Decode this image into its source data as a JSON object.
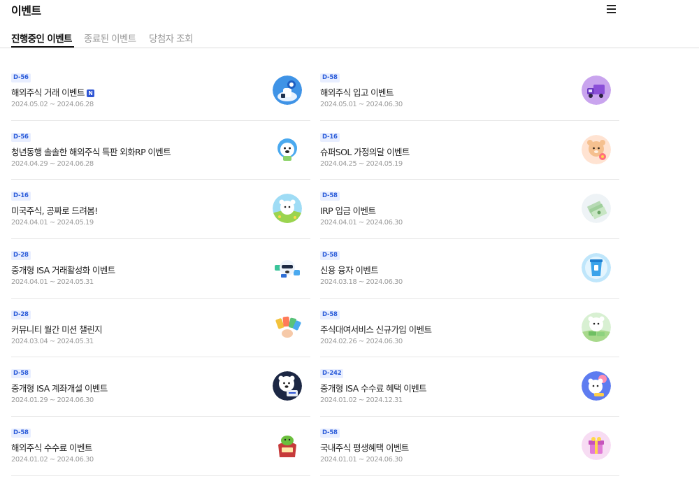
{
  "header": {
    "title": "이벤트",
    "menu_icon": "hamburger-menu-icon"
  },
  "tabs": [
    {
      "label": "진행중인 이벤트",
      "active": true
    },
    {
      "label": "종료된 이벤트",
      "active": false
    },
    {
      "label": "당첨자 조회",
      "active": false
    }
  ],
  "colors": {
    "badge_bg": "#e8eeff",
    "badge_text": "#2b5cd9",
    "new_badge": "#2f55d4"
  },
  "events_left": [
    {
      "dday": "D-56",
      "title": "해외주식 거래 이벤트",
      "new_label": "N",
      "period": "2024.05.02 ~ 2024.06.28",
      "icon": "rocket-launch-icon"
    },
    {
      "dday": "D-56",
      "title": "청년동행 솔솔한 해외주식 특판 외화RP 이벤트",
      "period": "2024.04.29 ~ 2024.06.28",
      "icon": "bear-mascot-icon"
    },
    {
      "dday": "D-16",
      "title": "미국주식, 공짜로 드려봄!",
      "period": "2024.04.01 ~ 2024.05.19",
      "icon": "bear-field-icon"
    },
    {
      "dday": "D-28",
      "title": "중개형 ISA 거래활성화 이벤트",
      "period": "2024.04.01 ~ 2024.05.31",
      "icon": "bear-sunglasses-icon"
    },
    {
      "dday": "D-28",
      "title": "커뮤니티 월간 미션 챌린지",
      "period": "2024.03.04 ~ 2024.05.31",
      "icon": "cards-hand-icon"
    },
    {
      "dday": "D-58",
      "title": "중개형 ISA 계좌개설 이벤트",
      "period": "2024.01.29 ~ 2024.06.30",
      "icon": "bear-coupon-icon"
    },
    {
      "dday": "D-58",
      "title": "해외주식 수수료 이벤트",
      "period": "2024.01.02 ~ 2024.06.30",
      "icon": "gift-pouch-icon"
    }
  ],
  "events_right": [
    {
      "dday": "D-58",
      "title": "해외주식 입고 이벤트",
      "period": "2024.05.01 ~ 2024.06.30",
      "icon": "truck-icon"
    },
    {
      "dday": "D-16",
      "title": "슈퍼SOL 가정의달 이벤트",
      "period": "2024.04.25 ~ 2024.05.19",
      "icon": "bear-flower-icon"
    },
    {
      "dday": "D-58",
      "title": "IRP 입금 이벤트",
      "period": "2024.04.01 ~ 2024.06.30",
      "icon": "money-stack-icon"
    },
    {
      "dday": "D-58",
      "title": "신용 융자 이벤트",
      "period": "2024.03.18 ~ 2024.06.30",
      "icon": "blue-cup-icon"
    },
    {
      "dday": "D-58",
      "title": "주식대여서비스 신규가입 이벤트",
      "period": "2024.02.26 ~ 2024.06.30",
      "icon": "bear-money-icon"
    },
    {
      "dday": "D-242",
      "title": "중개형 ISA 수수료 혜택 이벤트",
      "period": "2024.01.02 ~ 2024.12.31",
      "icon": "bear-balloon-icon"
    },
    {
      "dday": "D-58",
      "title": "국내주식 평생혜택 이벤트",
      "period": "2024.01.01 ~ 2024.06.30",
      "icon": "gift-box-icon"
    }
  ]
}
